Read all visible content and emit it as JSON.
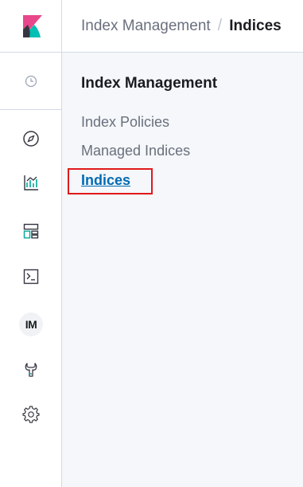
{
  "breadcrumb": {
    "parent": "Index Management",
    "separator": "/",
    "current": "Indices"
  },
  "sidebar": {
    "title": "Index Management",
    "items": [
      {
        "label": "Index Policies",
        "active": false
      },
      {
        "label": "Managed Indices",
        "active": false
      },
      {
        "label": "Indices",
        "active": true
      }
    ]
  },
  "rail": {
    "icons": [
      "kibana-logo",
      "clock-icon",
      "compass-icon",
      "visualize-icon",
      "dashboard-icon",
      "console-icon",
      "im-icon",
      "wrench-icon",
      "gear-icon"
    ],
    "im_label": "IM"
  },
  "colors": {
    "logo_pink": "#e8488b",
    "logo_teal": "#00bfb3",
    "logo_dark": "#343741",
    "active_link": "#006bb4",
    "highlight": "#e0191b"
  }
}
